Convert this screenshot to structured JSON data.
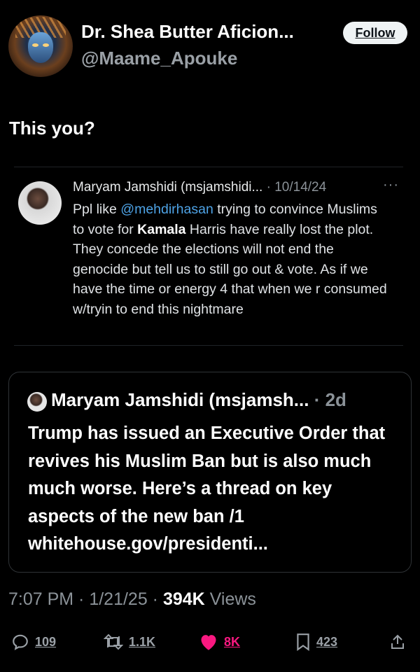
{
  "author": {
    "display_name": "Dr. Shea Butter Aficion...",
    "handle": "@Maame_Apouke",
    "follow_label": "Follow"
  },
  "tweet": {
    "text": "This you?",
    "timestamp": "7:07 PM · 1/21/25 · ",
    "views_count": "394K",
    "views_label": " Views"
  },
  "embedded_tweet": {
    "name": "Maryam Jamshidi (msjamshidi...",
    "date": " · 10/14/24",
    "more": "···",
    "body_before_mention": "Ppl like ",
    "mention": "@mehdirhasan",
    "body_middle": " trying to convince Muslims to vote for ",
    "bold_word": "Kamala",
    "body_after": " Harris have really lost the plot. They concede the elections will not end the genocide but tell us to still go out & vote. As if we have the time or energy 4 that when we r consumed w/tryin to end this nightmare"
  },
  "quoted_tweet": {
    "name": "Maryam Jamshidi (msjamsh...",
    "time": " · 2d",
    "body": "Trump has issued an Executive Order that revives his Muslim Ban but is also much much worse. Here’s a thread on key aspects of the new ban /1 whitehouse.gov/presidenti..."
  },
  "actions": {
    "replies": "109",
    "retweets": "1.1K",
    "likes": "8K",
    "bookmarks": "423"
  },
  "colors": {
    "like": "#f91880",
    "mention": "#4ea3e6",
    "muted": "#8b9298"
  }
}
